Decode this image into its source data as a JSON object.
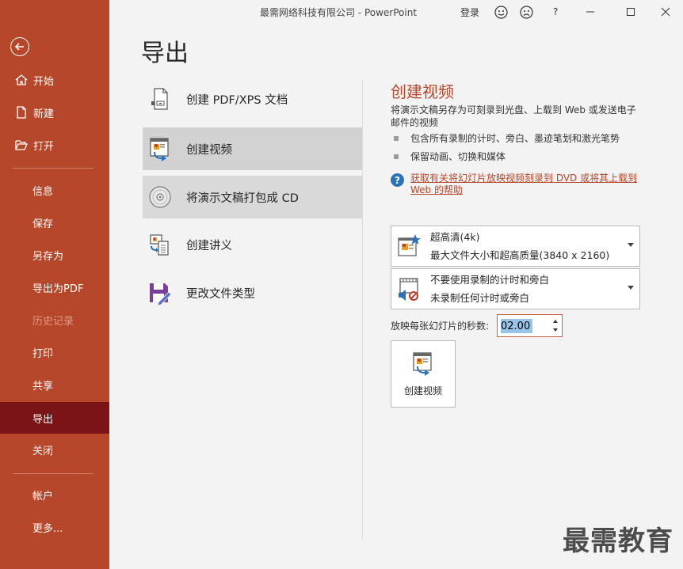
{
  "app": {
    "window_title": "最需网络科技有限公司  -  PowerPoint",
    "sign_in": "登录",
    "help": "?"
  },
  "sidebar": {
    "top_items": [
      {
        "label": "开始",
        "icon": "home-icon"
      },
      {
        "label": "新建",
        "icon": "new-document-icon"
      },
      {
        "label": "打开",
        "icon": "open-folder-icon"
      }
    ],
    "middle_items": [
      {
        "label": "信息"
      },
      {
        "label": "保存"
      },
      {
        "label": "另存为"
      },
      {
        "label": "导出为PDF"
      },
      {
        "label": "历史记录",
        "disabled": true
      },
      {
        "label": "打印"
      },
      {
        "label": "共享"
      },
      {
        "label": "导出",
        "active": true
      },
      {
        "label": "关闭"
      }
    ],
    "bottom_items": [
      {
        "label": "帐户"
      },
      {
        "label": "更多..."
      }
    ]
  },
  "main": {
    "title": "导出",
    "export_options": [
      {
        "label": "创建 PDF/XPS 文档",
        "icon": "pdf-document-icon"
      },
      {
        "label": "创建视频",
        "icon": "video-icon",
        "selected": true
      },
      {
        "label": "将演示文稿打包成 CD",
        "icon": "cd-icon"
      },
      {
        "label": "创建讲义",
        "icon": "handout-icon"
      },
      {
        "label": "更改文件类型",
        "icon": "save-as-icon"
      }
    ]
  },
  "video_panel": {
    "title": "创建视频",
    "description": "将演示文稿另存为可刻录到光盘、上载到 Web 或发送电子邮件的视频",
    "bullets": [
      "包含所有录制的计时、旁白、墨迹笔划和激光笔势",
      "保留动画、切换和媒体"
    ],
    "help_link": "获取有关将幻灯片放映视频刻录到 DVD 或将其上载到 Web 的帮助",
    "quality_dropdown": {
      "line1": "超高清(4k)",
      "line2": "最大文件大小和超高质量(3840 x 2160)"
    },
    "timing_dropdown": {
      "line1": "不要使用录制的计时和旁白",
      "line2": "未录制任何计时或旁白"
    },
    "seconds_label": "放映每张幻灯片的秒数:",
    "seconds_value": "02.00",
    "create_button": "创建视频"
  },
  "watermark": "最需教育",
  "colors": {
    "sidebar_bg": "#b7472a",
    "sidebar_active": "#7b1416",
    "accent": "#b7472a",
    "main_bg": "#f3f3f3"
  }
}
